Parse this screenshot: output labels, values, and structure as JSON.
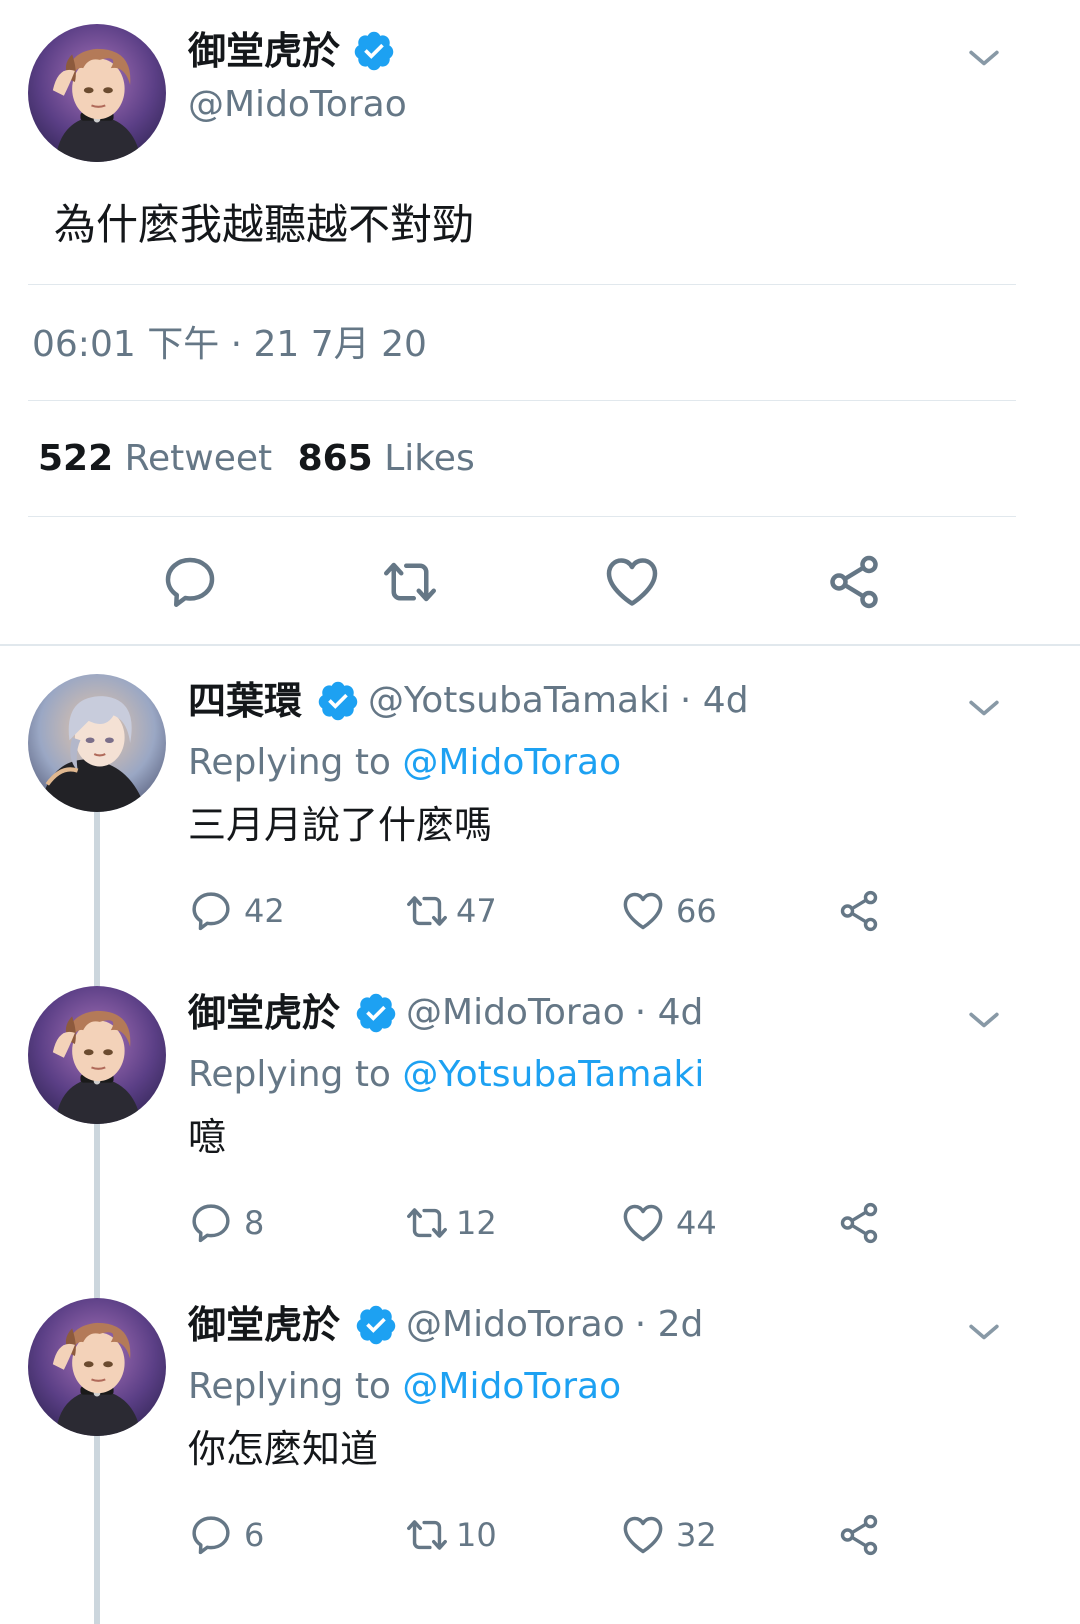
{
  "main_tweet": {
    "display_name": "御堂虎於",
    "handle": "@MidoTorao",
    "text": "為什麼我越聽越不對勁",
    "timestamp": "06:01 下午 · 21 7月 20",
    "retweet_count": "522",
    "retweet_label": "Retweet",
    "like_count": "865",
    "like_label": "Likes"
  },
  "replies": [
    {
      "display_name": "四葉環",
      "handle": "@YotsubaTamaki",
      "age": "· 4d",
      "replying_prefix": "Replying to",
      "replying_to": "@MidoTorao",
      "text": "三月月說了什麼嗎",
      "reply_count": "42",
      "retweet_count": "47",
      "like_count": "66"
    },
    {
      "display_name": "御堂虎於",
      "handle": "@MidoTorao",
      "age": "· 4d",
      "replying_prefix": "Replying to",
      "replying_to": "@YotsubaTamaki",
      "text": "噫",
      "reply_count": "8",
      "retweet_count": "12",
      "like_count": "44"
    },
    {
      "display_name": "御堂虎於",
      "handle": "@MidoTorao",
      "age": "· 2d",
      "replying_prefix": "Replying to",
      "replying_to": "@MidoTorao",
      "text": "你怎麼知道",
      "reply_count": "6",
      "retweet_count": "10",
      "like_count": "32"
    }
  ],
  "icons": {
    "verified": "verified-badge-icon",
    "chevron": "chevron-down-icon",
    "reply": "reply-icon",
    "retweet": "retweet-icon",
    "like": "heart-icon",
    "share": "share-icon"
  },
  "colors": {
    "accent": "#1da1f2",
    "text": "#14171a",
    "secondary": "#657786",
    "divider": "#e1e8ed",
    "thread_line": "#ccd6dd"
  }
}
